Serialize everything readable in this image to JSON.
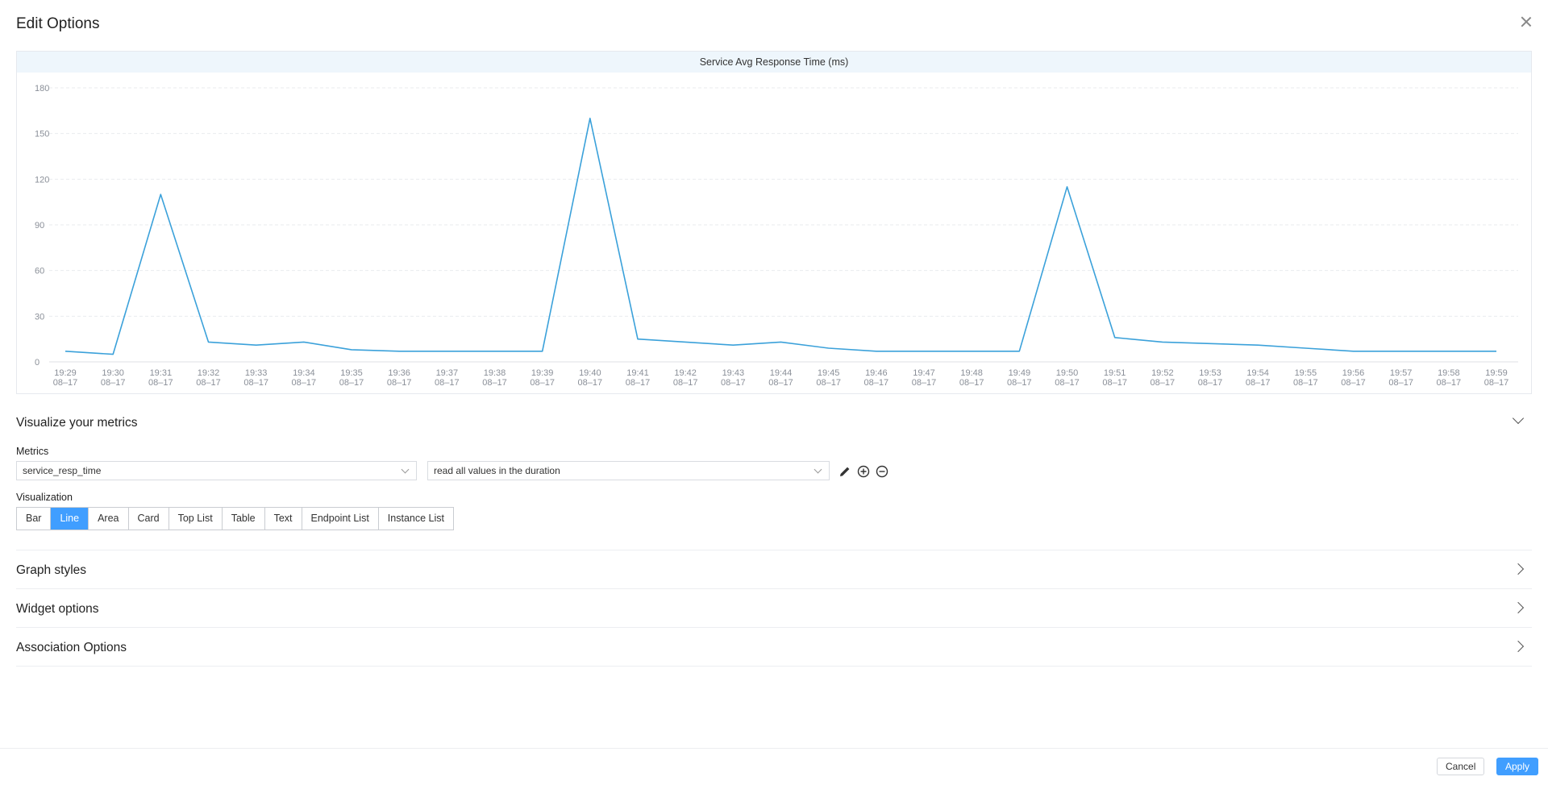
{
  "dialog": {
    "title": "Edit Options"
  },
  "chart_data": {
    "type": "line",
    "title": "Service Avg Response Time (ms)",
    "x": [
      "19:29",
      "19:30",
      "19:31",
      "19:32",
      "19:33",
      "19:34",
      "19:35",
      "19:36",
      "19:37",
      "19:38",
      "19:39",
      "19:40",
      "19:41",
      "19:42",
      "19:43",
      "19:44",
      "19:45",
      "19:46",
      "19:47",
      "19:48",
      "19:49",
      "19:50",
      "19:51",
      "19:52",
      "19:53",
      "19:54",
      "19:55",
      "19:56",
      "19:57",
      "19:58",
      "19:59"
    ],
    "x_sublabel": "08–17",
    "series": [
      {
        "values": [
          7,
          5,
          110,
          13,
          11,
          13,
          8,
          7,
          7,
          7,
          7,
          160,
          15,
          13,
          11,
          13,
          9,
          7,
          7,
          7,
          7,
          115,
          16,
          13,
          12,
          11,
          9,
          7,
          7,
          7,
          7
        ]
      }
    ],
    "yticks": [
      0,
      30,
      60,
      90,
      120,
      150,
      180
    ],
    "ylim": [
      0,
      180
    ],
    "grid": true,
    "color": "#3ba1da"
  },
  "visualize": {
    "heading": "Visualize your metrics",
    "metrics_label": "Metrics",
    "metric_value": "service_resp_time",
    "mode_value": "read all values in the duration",
    "visualization_label": "Visualization",
    "types": [
      "Bar",
      "Line",
      "Area",
      "Card",
      "Top List",
      "Table",
      "Text",
      "Endpoint List",
      "Instance List"
    ],
    "selected_type": "Line",
    "icons": [
      "pencil-icon",
      "add-circle-icon",
      "remove-circle-icon"
    ]
  },
  "sections": {
    "graph_styles": "Graph styles",
    "widget_options": "Widget options",
    "association_options": "Association Options"
  },
  "footer": {
    "cancel_label": "Cancel",
    "apply_label": "Apply"
  },
  "colors": {
    "accent": "#409eff",
    "line": "#3ba1da",
    "header_bg": "#eef6fc"
  }
}
